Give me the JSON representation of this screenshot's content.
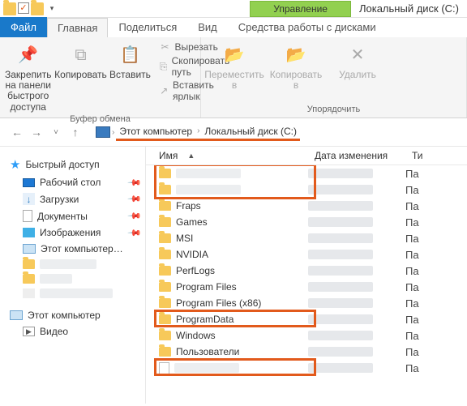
{
  "window": {
    "context": "Управление",
    "title": "Локальный диск (C:)"
  },
  "tabs": {
    "file": "Файл",
    "home": "Главная",
    "share": "Поделиться",
    "view": "Вид",
    "tools": "Средства работы с дисками"
  },
  "ribbon": {
    "pin": "Закрепить на панели быстрого доступа",
    "copy": "Копировать",
    "paste": "Вставить",
    "cut": "Вырезать",
    "copypath": "Скопировать путь",
    "pastelink": "Вставить ярлык",
    "group_clip": "Буфер обмена",
    "move": "Переместить в",
    "copyto": "Копировать в",
    "delete": "Удалить",
    "group_org": "Упорядочить"
  },
  "nav": {
    "pc": "Этот компьютер",
    "drive": "Локальный диск (C:)"
  },
  "sidebar": {
    "quick": "Быстрый доступ",
    "desktop": "Рабочий стол",
    "downloads": "Загрузки",
    "documents": "Документы",
    "pictures": "Изображения",
    "thispc_side": "Этот компьютер…",
    "thispc": "Этот компьютер",
    "videos": "Видео"
  },
  "list": {
    "col_name": "Имя",
    "col_date": "Дата изменения",
    "col_type": "Ти",
    "rows": [
      {
        "name": "",
        "type": "Па",
        "blur": true
      },
      {
        "name": "",
        "type": "Па",
        "blur": true
      },
      {
        "name": "Fraps",
        "type": "Па"
      },
      {
        "name": "Games",
        "type": "Па"
      },
      {
        "name": "MSI",
        "type": "Па"
      },
      {
        "name": "NVIDIA",
        "type": "Па"
      },
      {
        "name": "PerfLogs",
        "type": "Па"
      },
      {
        "name": "Program Files",
        "type": "Па"
      },
      {
        "name": "Program Files (x86)",
        "type": "Па"
      },
      {
        "name": "ProgramData",
        "type": "Па"
      },
      {
        "name": "Windows",
        "type": "Па"
      },
      {
        "name": "Пользователи",
        "type": "Па"
      },
      {
        "name": "",
        "type": "Па",
        "blur": true,
        "file": true
      }
    ]
  }
}
